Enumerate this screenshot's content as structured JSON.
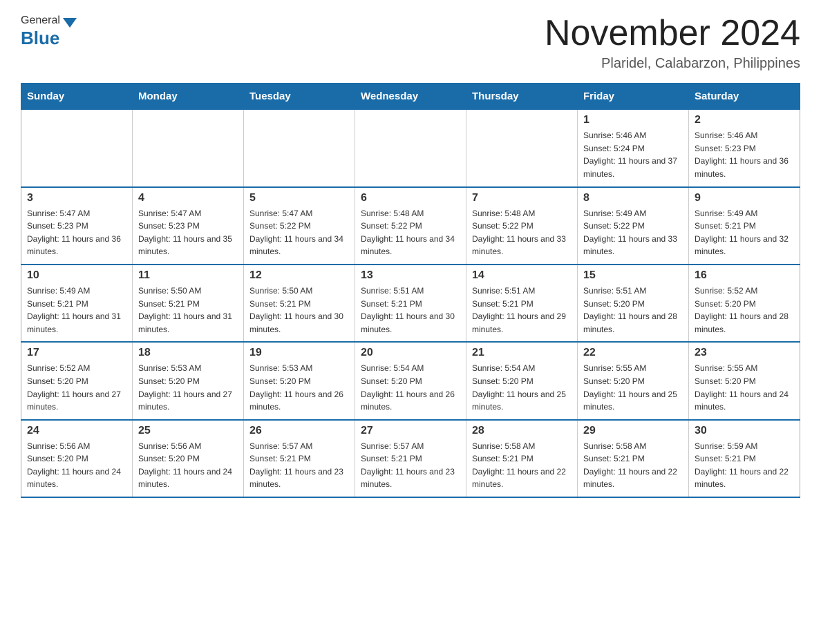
{
  "header": {
    "logo_general": "General",
    "logo_blue": "Blue",
    "month_year": "November 2024",
    "location": "Plaridel, Calabarzon, Philippines"
  },
  "weekdays": [
    "Sunday",
    "Monday",
    "Tuesday",
    "Wednesday",
    "Thursday",
    "Friday",
    "Saturday"
  ],
  "weeks": [
    [
      {
        "day": "",
        "sunrise": "",
        "sunset": "",
        "daylight": ""
      },
      {
        "day": "",
        "sunrise": "",
        "sunset": "",
        "daylight": ""
      },
      {
        "day": "",
        "sunrise": "",
        "sunset": "",
        "daylight": ""
      },
      {
        "day": "",
        "sunrise": "",
        "sunset": "",
        "daylight": ""
      },
      {
        "day": "",
        "sunrise": "",
        "sunset": "",
        "daylight": ""
      },
      {
        "day": "1",
        "sunrise": "Sunrise: 5:46 AM",
        "sunset": "Sunset: 5:24 PM",
        "daylight": "Daylight: 11 hours and 37 minutes."
      },
      {
        "day": "2",
        "sunrise": "Sunrise: 5:46 AM",
        "sunset": "Sunset: 5:23 PM",
        "daylight": "Daylight: 11 hours and 36 minutes."
      }
    ],
    [
      {
        "day": "3",
        "sunrise": "Sunrise: 5:47 AM",
        "sunset": "Sunset: 5:23 PM",
        "daylight": "Daylight: 11 hours and 36 minutes."
      },
      {
        "day": "4",
        "sunrise": "Sunrise: 5:47 AM",
        "sunset": "Sunset: 5:23 PM",
        "daylight": "Daylight: 11 hours and 35 minutes."
      },
      {
        "day": "5",
        "sunrise": "Sunrise: 5:47 AM",
        "sunset": "Sunset: 5:22 PM",
        "daylight": "Daylight: 11 hours and 34 minutes."
      },
      {
        "day": "6",
        "sunrise": "Sunrise: 5:48 AM",
        "sunset": "Sunset: 5:22 PM",
        "daylight": "Daylight: 11 hours and 34 minutes."
      },
      {
        "day": "7",
        "sunrise": "Sunrise: 5:48 AM",
        "sunset": "Sunset: 5:22 PM",
        "daylight": "Daylight: 11 hours and 33 minutes."
      },
      {
        "day": "8",
        "sunrise": "Sunrise: 5:49 AM",
        "sunset": "Sunset: 5:22 PM",
        "daylight": "Daylight: 11 hours and 33 minutes."
      },
      {
        "day": "9",
        "sunrise": "Sunrise: 5:49 AM",
        "sunset": "Sunset: 5:21 PM",
        "daylight": "Daylight: 11 hours and 32 minutes."
      }
    ],
    [
      {
        "day": "10",
        "sunrise": "Sunrise: 5:49 AM",
        "sunset": "Sunset: 5:21 PM",
        "daylight": "Daylight: 11 hours and 31 minutes."
      },
      {
        "day": "11",
        "sunrise": "Sunrise: 5:50 AM",
        "sunset": "Sunset: 5:21 PM",
        "daylight": "Daylight: 11 hours and 31 minutes."
      },
      {
        "day": "12",
        "sunrise": "Sunrise: 5:50 AM",
        "sunset": "Sunset: 5:21 PM",
        "daylight": "Daylight: 11 hours and 30 minutes."
      },
      {
        "day": "13",
        "sunrise": "Sunrise: 5:51 AM",
        "sunset": "Sunset: 5:21 PM",
        "daylight": "Daylight: 11 hours and 30 minutes."
      },
      {
        "day": "14",
        "sunrise": "Sunrise: 5:51 AM",
        "sunset": "Sunset: 5:21 PM",
        "daylight": "Daylight: 11 hours and 29 minutes."
      },
      {
        "day": "15",
        "sunrise": "Sunrise: 5:51 AM",
        "sunset": "Sunset: 5:20 PM",
        "daylight": "Daylight: 11 hours and 28 minutes."
      },
      {
        "day": "16",
        "sunrise": "Sunrise: 5:52 AM",
        "sunset": "Sunset: 5:20 PM",
        "daylight": "Daylight: 11 hours and 28 minutes."
      }
    ],
    [
      {
        "day": "17",
        "sunrise": "Sunrise: 5:52 AM",
        "sunset": "Sunset: 5:20 PM",
        "daylight": "Daylight: 11 hours and 27 minutes."
      },
      {
        "day": "18",
        "sunrise": "Sunrise: 5:53 AM",
        "sunset": "Sunset: 5:20 PM",
        "daylight": "Daylight: 11 hours and 27 minutes."
      },
      {
        "day": "19",
        "sunrise": "Sunrise: 5:53 AM",
        "sunset": "Sunset: 5:20 PM",
        "daylight": "Daylight: 11 hours and 26 minutes."
      },
      {
        "day": "20",
        "sunrise": "Sunrise: 5:54 AM",
        "sunset": "Sunset: 5:20 PM",
        "daylight": "Daylight: 11 hours and 26 minutes."
      },
      {
        "day": "21",
        "sunrise": "Sunrise: 5:54 AM",
        "sunset": "Sunset: 5:20 PM",
        "daylight": "Daylight: 11 hours and 25 minutes."
      },
      {
        "day": "22",
        "sunrise": "Sunrise: 5:55 AM",
        "sunset": "Sunset: 5:20 PM",
        "daylight": "Daylight: 11 hours and 25 minutes."
      },
      {
        "day": "23",
        "sunrise": "Sunrise: 5:55 AM",
        "sunset": "Sunset: 5:20 PM",
        "daylight": "Daylight: 11 hours and 24 minutes."
      }
    ],
    [
      {
        "day": "24",
        "sunrise": "Sunrise: 5:56 AM",
        "sunset": "Sunset: 5:20 PM",
        "daylight": "Daylight: 11 hours and 24 minutes."
      },
      {
        "day": "25",
        "sunrise": "Sunrise: 5:56 AM",
        "sunset": "Sunset: 5:20 PM",
        "daylight": "Daylight: 11 hours and 24 minutes."
      },
      {
        "day": "26",
        "sunrise": "Sunrise: 5:57 AM",
        "sunset": "Sunset: 5:21 PM",
        "daylight": "Daylight: 11 hours and 23 minutes."
      },
      {
        "day": "27",
        "sunrise": "Sunrise: 5:57 AM",
        "sunset": "Sunset: 5:21 PM",
        "daylight": "Daylight: 11 hours and 23 minutes."
      },
      {
        "day": "28",
        "sunrise": "Sunrise: 5:58 AM",
        "sunset": "Sunset: 5:21 PM",
        "daylight": "Daylight: 11 hours and 22 minutes."
      },
      {
        "day": "29",
        "sunrise": "Sunrise: 5:58 AM",
        "sunset": "Sunset: 5:21 PM",
        "daylight": "Daylight: 11 hours and 22 minutes."
      },
      {
        "day": "30",
        "sunrise": "Sunrise: 5:59 AM",
        "sunset": "Sunset: 5:21 PM",
        "daylight": "Daylight: 11 hours and 22 minutes."
      }
    ]
  ]
}
